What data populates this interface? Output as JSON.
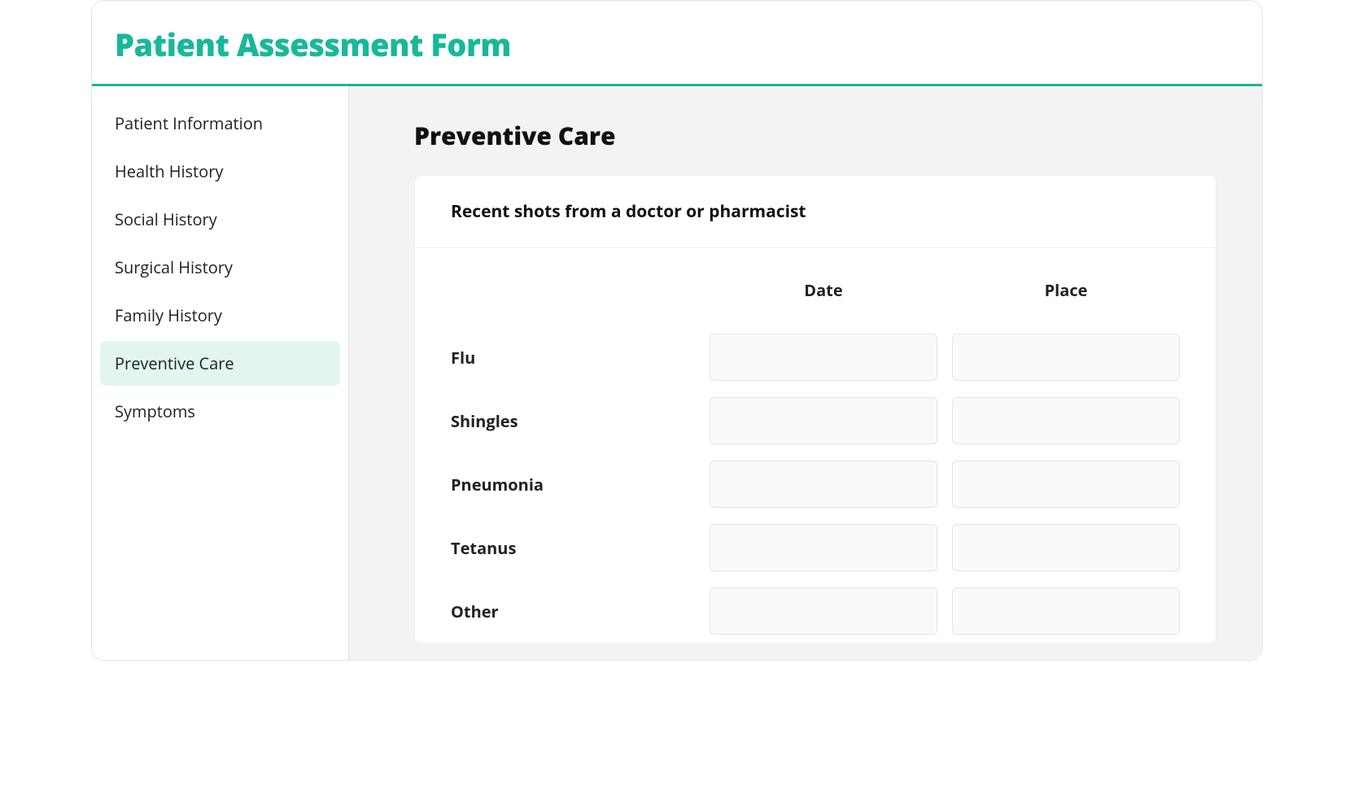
{
  "header": {
    "title": "Patient Assessment Form"
  },
  "sidebar": {
    "items": [
      {
        "label": "Patient Information",
        "key": "patient-information",
        "active": false
      },
      {
        "label": "Health History",
        "key": "health-history",
        "active": false
      },
      {
        "label": "Social History",
        "key": "social-history",
        "active": false
      },
      {
        "label": "Surgical History",
        "key": "surgical-history",
        "active": false
      },
      {
        "label": "Family History",
        "key": "family-history",
        "active": false
      },
      {
        "label": "Preventive Care",
        "key": "preventive-care",
        "active": true
      },
      {
        "label": "Symptoms",
        "key": "symptoms",
        "active": false
      }
    ]
  },
  "main": {
    "title": "Preventive Care",
    "card": {
      "heading": "Recent shots from a doctor or pharmacist",
      "columns": [
        "Date",
        "Place"
      ],
      "rows": [
        {
          "label": "Flu",
          "date": "",
          "place": ""
        },
        {
          "label": "Shingles",
          "date": "",
          "place": ""
        },
        {
          "label": "Pneumonia",
          "date": "",
          "place": ""
        },
        {
          "label": "Tetanus",
          "date": "",
          "place": ""
        },
        {
          "label": "Other",
          "date": "",
          "place": ""
        }
      ]
    }
  }
}
